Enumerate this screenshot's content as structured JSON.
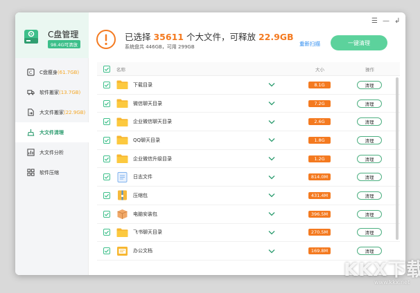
{
  "app": {
    "title": "C盘管理",
    "badge": "98.4G可清放"
  },
  "window_controls": [
    "☰",
    "—",
    "↲"
  ],
  "sidebar": {
    "items": [
      {
        "label": "C盘瘦身",
        "sub": "(61.7GB)",
        "icon": "disk-icon",
        "active": false
      },
      {
        "label": "软件搬家",
        "sub": "(13.7GB)",
        "icon": "truck-icon",
        "active": false
      },
      {
        "label": "大文件搬家",
        "sub": "(22.9GB)",
        "icon": "file-move-icon",
        "active": false
      },
      {
        "label": "大文件清理",
        "sub": "",
        "icon": "broom-icon",
        "active": true
      },
      {
        "label": "大文件分析",
        "sub": "",
        "icon": "analysis-icon",
        "active": false
      },
      {
        "label": "软件压缩",
        "sub": "",
        "icon": "compress-icon",
        "active": false
      }
    ]
  },
  "summary": {
    "prefix": "已选择 ",
    "count": "35611",
    "middle": " 个大文件，可释放 ",
    "size": "22.9GB",
    "disk_info": "系统盘共 446GB，可用 299GB"
  },
  "actions": {
    "rescan": "重新扫描",
    "clean_all": "一键清理"
  },
  "table": {
    "headers": {
      "name": "名称",
      "size": "大小",
      "action": "操作"
    },
    "rows": [
      {
        "name": "下载目录",
        "size": "8.1G",
        "type": "folder",
        "action": "清理"
      },
      {
        "name": "微信聊天目录",
        "size": "7.2G",
        "type": "folder",
        "action": "清理"
      },
      {
        "name": "企业微信聊天目录",
        "size": "2.6G",
        "type": "folder",
        "action": "清理"
      },
      {
        "name": "QQ聊天目录",
        "size": "1.8G",
        "type": "folder",
        "action": "清理"
      },
      {
        "name": "企业微信升级目录",
        "size": "1.2G",
        "type": "folder",
        "action": "清理"
      },
      {
        "name": "日志文件",
        "size": "814.0M",
        "type": "log",
        "action": "清理"
      },
      {
        "name": "压缩包",
        "size": "431.4M",
        "type": "zip",
        "action": "清理"
      },
      {
        "name": "电脑安装包",
        "size": "396.5M",
        "type": "package",
        "action": "清理"
      },
      {
        "name": "飞书聊天目录",
        "size": "270.5M",
        "type": "folder",
        "action": "清理"
      },
      {
        "name": "办公文档",
        "size": "169.8M",
        "type": "doc",
        "action": "清理"
      }
    ]
  },
  "watermark": {
    "text": "KKX下载",
    "sub": "www.kkx.net"
  },
  "colors": {
    "accent": "#3dbf8a",
    "orange": "#f47a20",
    "link": "#2d8cf0"
  }
}
